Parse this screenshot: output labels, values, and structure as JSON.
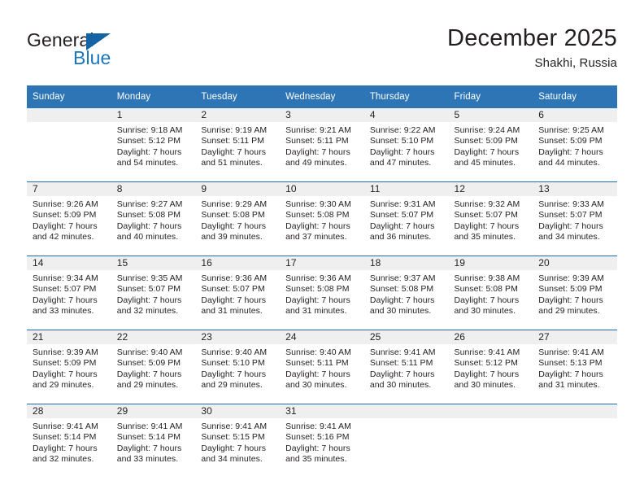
{
  "brand": {
    "name_top": "General",
    "name_bottom": "Blue",
    "accent_color": "#1b75bb",
    "triangle_color": "#1464a5"
  },
  "header": {
    "title": "December 2025",
    "subtitle": "Shakhi, Russia"
  },
  "theme": {
    "header_row_bg": "#2e75b6",
    "daynum_bg": "#efefef",
    "row_separator": "#1f6bb0",
    "text": "#231f20"
  },
  "calendar": {
    "weekday_headers": [
      "Sunday",
      "Monday",
      "Tuesday",
      "Wednesday",
      "Thursday",
      "Friday",
      "Saturday"
    ],
    "weeks": [
      [
        {
          "day": "",
          "lines": []
        },
        {
          "day": "1",
          "lines": [
            "Sunrise: 9:18 AM",
            "Sunset: 5:12 PM",
            "Daylight: 7 hours",
            "and 54 minutes."
          ]
        },
        {
          "day": "2",
          "lines": [
            "Sunrise: 9:19 AM",
            "Sunset: 5:11 PM",
            "Daylight: 7 hours",
            "and 51 minutes."
          ]
        },
        {
          "day": "3",
          "lines": [
            "Sunrise: 9:21 AM",
            "Sunset: 5:11 PM",
            "Daylight: 7 hours",
            "and 49 minutes."
          ]
        },
        {
          "day": "4",
          "lines": [
            "Sunrise: 9:22 AM",
            "Sunset: 5:10 PM",
            "Daylight: 7 hours",
            "and 47 minutes."
          ]
        },
        {
          "day": "5",
          "lines": [
            "Sunrise: 9:24 AM",
            "Sunset: 5:09 PM",
            "Daylight: 7 hours",
            "and 45 minutes."
          ]
        },
        {
          "day": "6",
          "lines": [
            "Sunrise: 9:25 AM",
            "Sunset: 5:09 PM",
            "Daylight: 7 hours",
            "and 44 minutes."
          ]
        }
      ],
      [
        {
          "day": "7",
          "lines": [
            "Sunrise: 9:26 AM",
            "Sunset: 5:09 PM",
            "Daylight: 7 hours",
            "and 42 minutes."
          ]
        },
        {
          "day": "8",
          "lines": [
            "Sunrise: 9:27 AM",
            "Sunset: 5:08 PM",
            "Daylight: 7 hours",
            "and 40 minutes."
          ]
        },
        {
          "day": "9",
          "lines": [
            "Sunrise: 9:29 AM",
            "Sunset: 5:08 PM",
            "Daylight: 7 hours",
            "and 39 minutes."
          ]
        },
        {
          "day": "10",
          "lines": [
            "Sunrise: 9:30 AM",
            "Sunset: 5:08 PM",
            "Daylight: 7 hours",
            "and 37 minutes."
          ]
        },
        {
          "day": "11",
          "lines": [
            "Sunrise: 9:31 AM",
            "Sunset: 5:07 PM",
            "Daylight: 7 hours",
            "and 36 minutes."
          ]
        },
        {
          "day": "12",
          "lines": [
            "Sunrise: 9:32 AM",
            "Sunset: 5:07 PM",
            "Daylight: 7 hours",
            "and 35 minutes."
          ]
        },
        {
          "day": "13",
          "lines": [
            "Sunrise: 9:33 AM",
            "Sunset: 5:07 PM",
            "Daylight: 7 hours",
            "and 34 minutes."
          ]
        }
      ],
      [
        {
          "day": "14",
          "lines": [
            "Sunrise: 9:34 AM",
            "Sunset: 5:07 PM",
            "Daylight: 7 hours",
            "and 33 minutes."
          ]
        },
        {
          "day": "15",
          "lines": [
            "Sunrise: 9:35 AM",
            "Sunset: 5:07 PM",
            "Daylight: 7 hours",
            "and 32 minutes."
          ]
        },
        {
          "day": "16",
          "lines": [
            "Sunrise: 9:36 AM",
            "Sunset: 5:07 PM",
            "Daylight: 7 hours",
            "and 31 minutes."
          ]
        },
        {
          "day": "17",
          "lines": [
            "Sunrise: 9:36 AM",
            "Sunset: 5:08 PM",
            "Daylight: 7 hours",
            "and 31 minutes."
          ]
        },
        {
          "day": "18",
          "lines": [
            "Sunrise: 9:37 AM",
            "Sunset: 5:08 PM",
            "Daylight: 7 hours",
            "and 30 minutes."
          ]
        },
        {
          "day": "19",
          "lines": [
            "Sunrise: 9:38 AM",
            "Sunset: 5:08 PM",
            "Daylight: 7 hours",
            "and 30 minutes."
          ]
        },
        {
          "day": "20",
          "lines": [
            "Sunrise: 9:39 AM",
            "Sunset: 5:09 PM",
            "Daylight: 7 hours",
            "and 29 minutes."
          ]
        }
      ],
      [
        {
          "day": "21",
          "lines": [
            "Sunrise: 9:39 AM",
            "Sunset: 5:09 PM",
            "Daylight: 7 hours",
            "and 29 minutes."
          ]
        },
        {
          "day": "22",
          "lines": [
            "Sunrise: 9:40 AM",
            "Sunset: 5:09 PM",
            "Daylight: 7 hours",
            "and 29 minutes."
          ]
        },
        {
          "day": "23",
          "lines": [
            "Sunrise: 9:40 AM",
            "Sunset: 5:10 PM",
            "Daylight: 7 hours",
            "and 29 minutes."
          ]
        },
        {
          "day": "24",
          "lines": [
            "Sunrise: 9:40 AM",
            "Sunset: 5:11 PM",
            "Daylight: 7 hours",
            "and 30 minutes."
          ]
        },
        {
          "day": "25",
          "lines": [
            "Sunrise: 9:41 AM",
            "Sunset: 5:11 PM",
            "Daylight: 7 hours",
            "and 30 minutes."
          ]
        },
        {
          "day": "26",
          "lines": [
            "Sunrise: 9:41 AM",
            "Sunset: 5:12 PM",
            "Daylight: 7 hours",
            "and 30 minutes."
          ]
        },
        {
          "day": "27",
          "lines": [
            "Sunrise: 9:41 AM",
            "Sunset: 5:13 PM",
            "Daylight: 7 hours",
            "and 31 minutes."
          ]
        }
      ],
      [
        {
          "day": "28",
          "lines": [
            "Sunrise: 9:41 AM",
            "Sunset: 5:14 PM",
            "Daylight: 7 hours",
            "and 32 minutes."
          ]
        },
        {
          "day": "29",
          "lines": [
            "Sunrise: 9:41 AM",
            "Sunset: 5:14 PM",
            "Daylight: 7 hours",
            "and 33 minutes."
          ]
        },
        {
          "day": "30",
          "lines": [
            "Sunrise: 9:41 AM",
            "Sunset: 5:15 PM",
            "Daylight: 7 hours",
            "and 34 minutes."
          ]
        },
        {
          "day": "31",
          "lines": [
            "Sunrise: 9:41 AM",
            "Sunset: 5:16 PM",
            "Daylight: 7 hours",
            "and 35 minutes."
          ]
        },
        {
          "day": "",
          "lines": []
        },
        {
          "day": "",
          "lines": []
        },
        {
          "day": "",
          "lines": []
        }
      ]
    ]
  }
}
